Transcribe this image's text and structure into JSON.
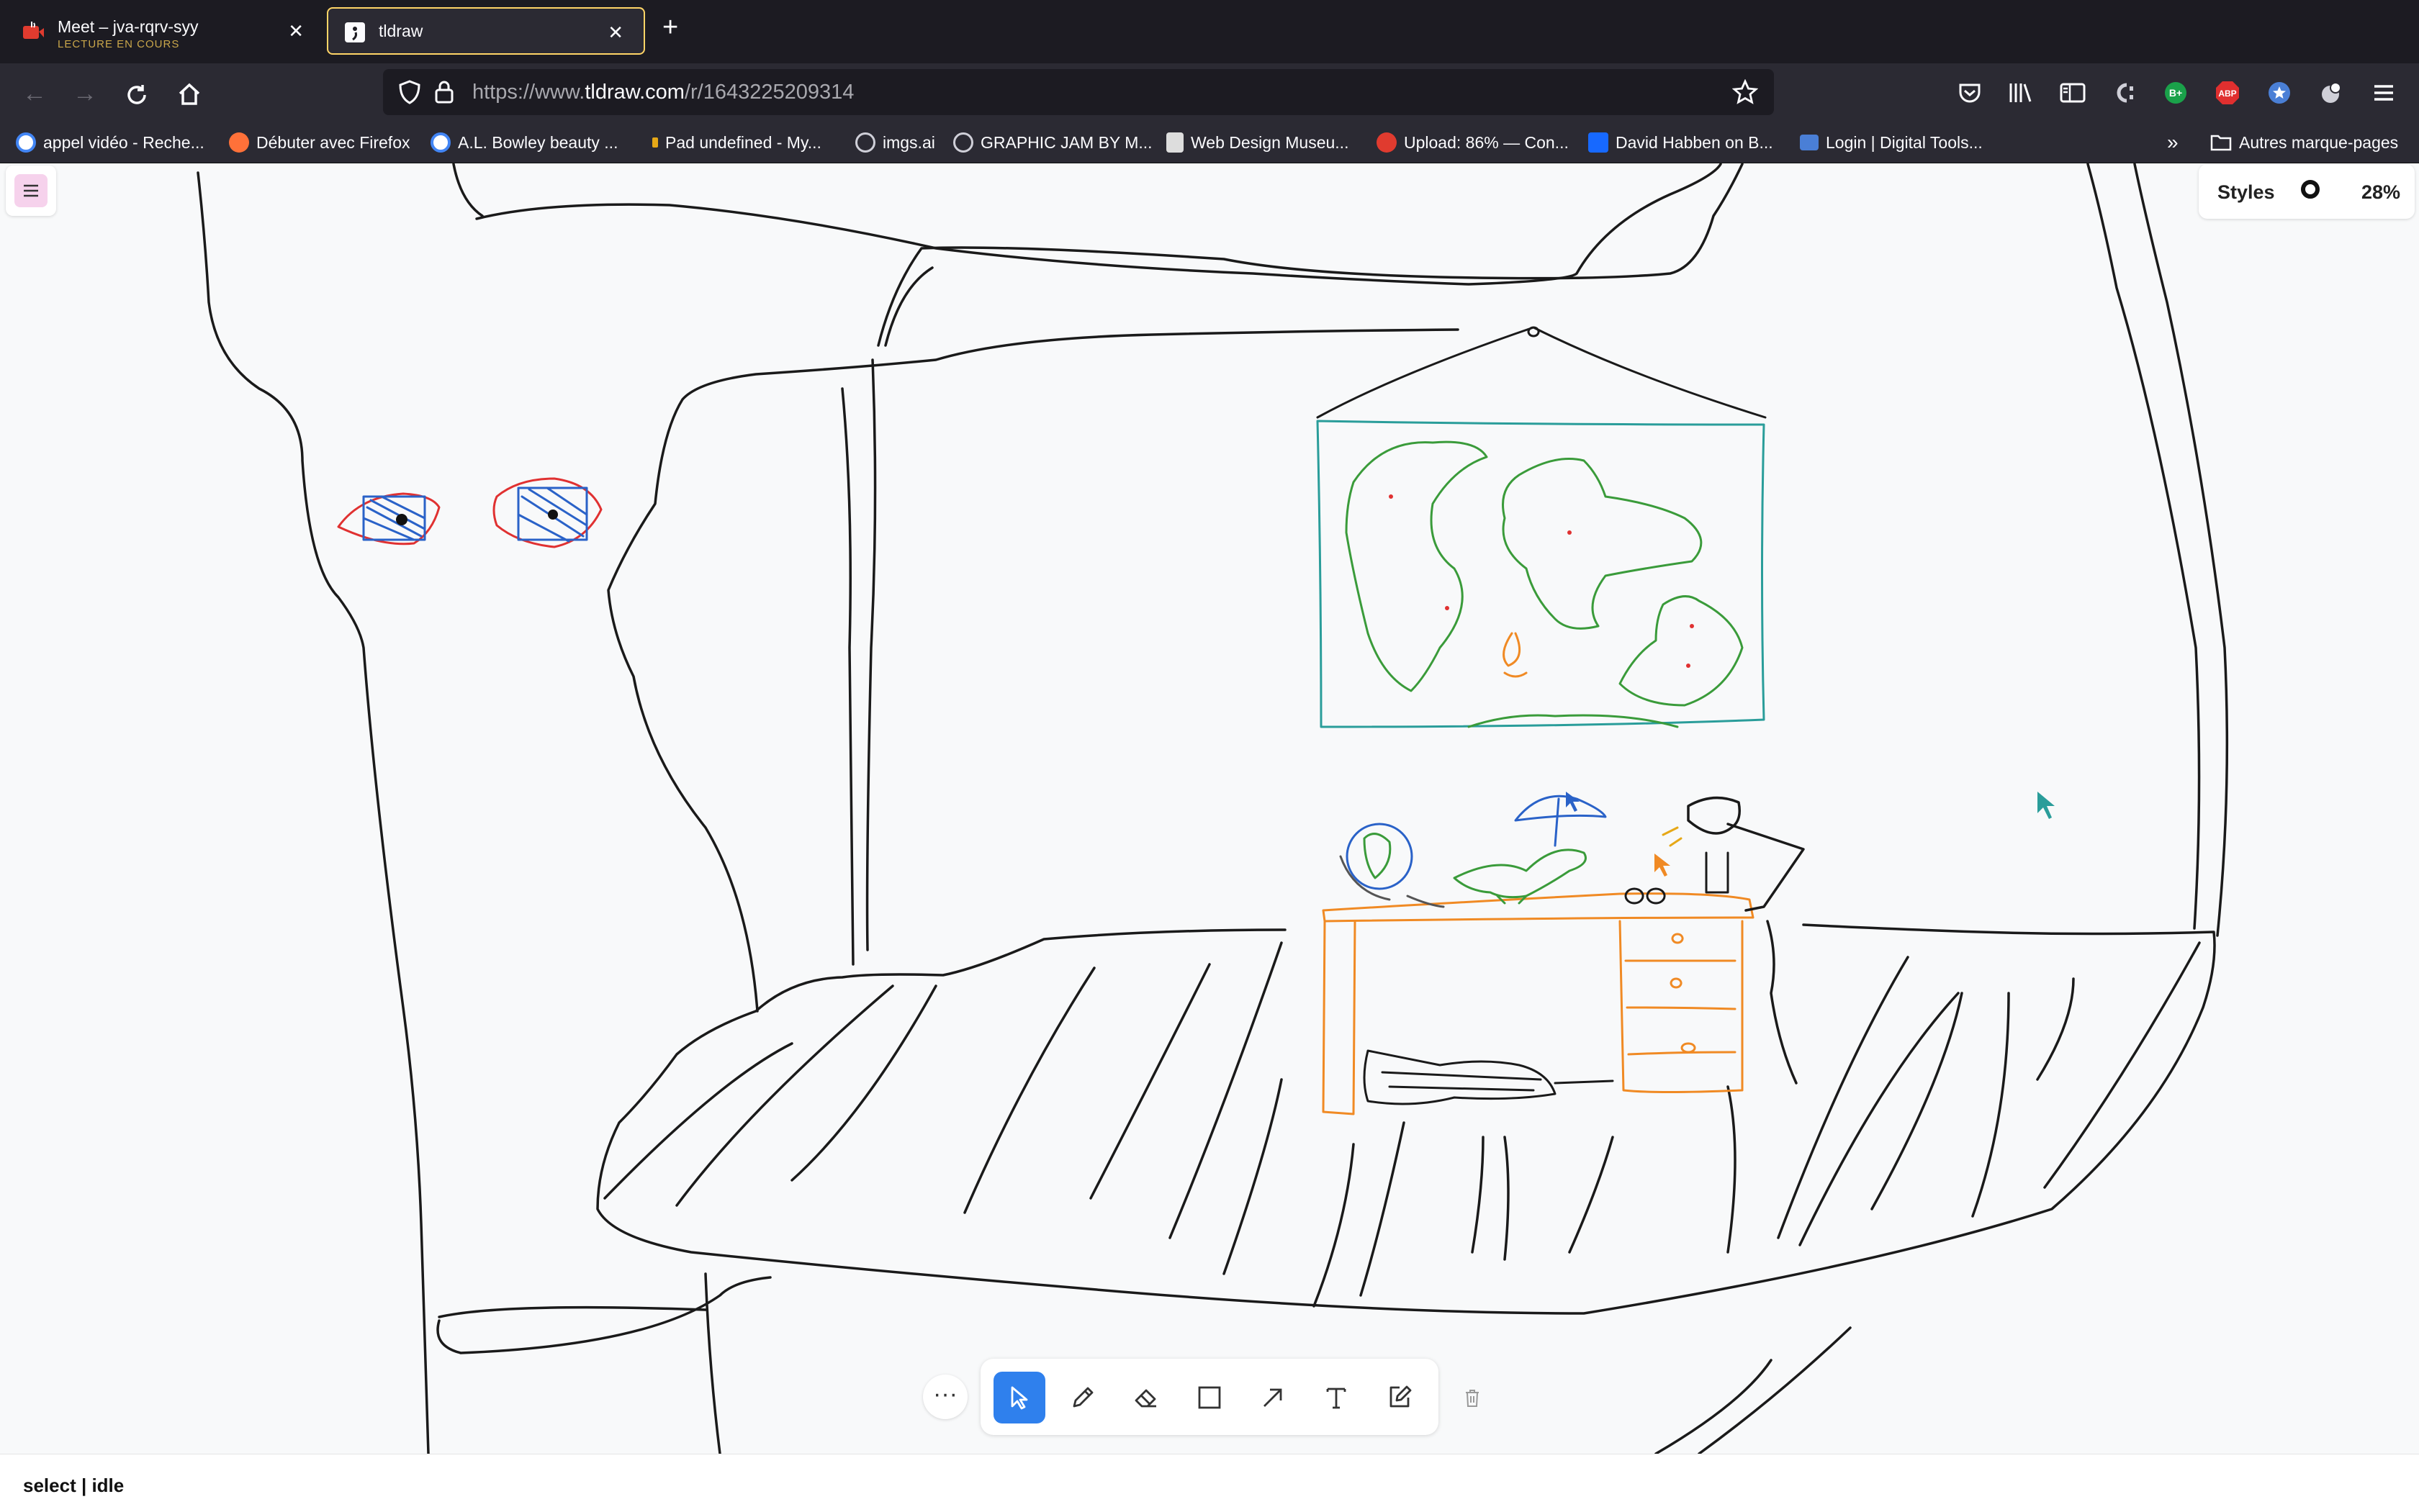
{
  "tabs": [
    {
      "title": "Meet – jva-rqrv-syy",
      "subtitle": "LECTURE EN COURS",
      "favicon": "meet-audio-icon"
    },
    {
      "title": "tldraw",
      "favicon": "tldraw-icon",
      "active": true
    }
  ],
  "nav": {
    "url_prefix": "https://www.",
    "url_domain": "tldraw.com",
    "url_path": "/r/1643225209314"
  },
  "bookmarks": [
    {
      "label": "appel vidéo - Reche...",
      "icon": "google-icon",
      "color": "#4285f4"
    },
    {
      "label": "Débuter avec Firefox",
      "icon": "firefox-icon",
      "color": "#ff7139"
    },
    {
      "label": "A.L. Bowley beauty ...",
      "icon": "google-icon",
      "color": "#4285f4"
    },
    {
      "label": "Pad undefined - My...",
      "icon": "pad-icon",
      "color": "#e6a817"
    },
    {
      "label": "imgs.ai",
      "icon": "globe-icon",
      "color": "#bbbbbb"
    },
    {
      "label": "GRAPHIC JAM BY M...",
      "icon": "globe-icon",
      "color": "#bbbbbb"
    },
    {
      "label": "Web Design Museu...",
      "icon": "museum-icon",
      "color": "#dddddd"
    },
    {
      "label": "Upload: 86% — Con...",
      "icon": "upload-icon",
      "color": "#e03b2f"
    },
    {
      "label": "David Habben on B...",
      "icon": "behance-icon",
      "color": "#1769ff"
    },
    {
      "label": "Login | Digital Tools...",
      "icon": "tools-icon",
      "color": "#4a7fd6"
    }
  ],
  "bookmarks_other": "Autres marque-pages",
  "styles_panel": {
    "label": "Styles",
    "zoom": "28%"
  },
  "toolbar": {
    "more_label": "···",
    "tools": [
      "select",
      "draw",
      "eraser",
      "rectangle",
      "arrow",
      "text",
      "sticky-note"
    ],
    "active_tool": "select"
  },
  "status": "select | idle",
  "colors": {
    "accent": "#2f80ed",
    "tab_highlight": "#ffd567",
    "drawing_orange": "#f08a24",
    "drawing_green": "#3a9b3a",
    "drawing_teal": "#2a9d9a",
    "drawing_blue": "#2a62c8",
    "drawing_red": "#e03131"
  }
}
